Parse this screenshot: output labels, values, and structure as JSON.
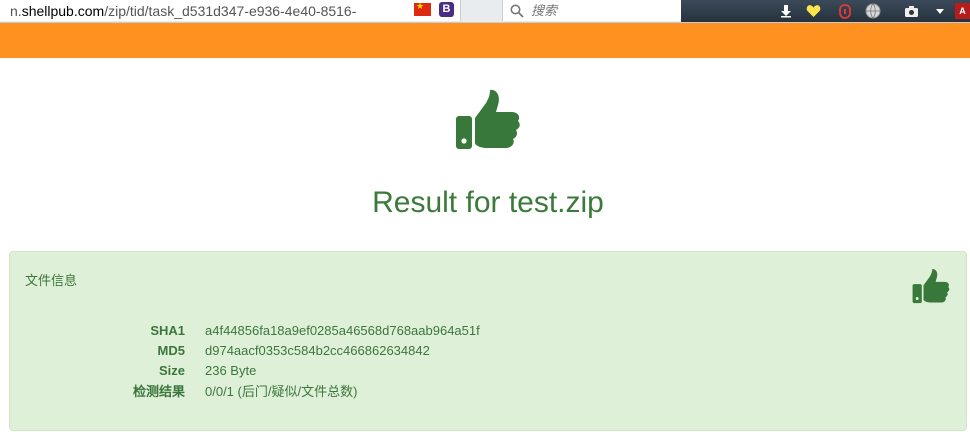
{
  "browser": {
    "url_prefix": "n.",
    "url_domain": "shellpub.com",
    "url_path": "/zip/tid/task_d531d347-e936-4e40-8516-",
    "search_placeholder": "搜索",
    "icons": [
      "china-flag-icon",
      "bootstrap-b-icon",
      "reload-icon",
      "search-icon",
      "download-icon",
      "heart-icon",
      "shield-icon",
      "globe-icon",
      "camera-icon",
      "menu-arrow-icon"
    ]
  },
  "colors": {
    "brand_bar": "#ff9120",
    "success_text": "#3c763d",
    "title_green": "#3b7a3a",
    "panel_bg": "#dff0d8",
    "thumb_green": "#38783b"
  },
  "main": {
    "hero_icon": "thumbs-up-icon",
    "title": "Result for test.zip"
  },
  "panel": {
    "heading": "文件信息",
    "icon": "thumbs-up-icon",
    "rows": [
      {
        "key": "SHA1",
        "value": "a4f44856fa18a9ef0285a46568d768aab964a51f"
      },
      {
        "key": "MD5",
        "value": "d974aacf0353c584b2cc466862634842"
      },
      {
        "key": "Size",
        "value": "236 Byte"
      },
      {
        "key": "检测结果",
        "value": "0/0/1 (后门/疑似/文件总数)"
      }
    ]
  }
}
